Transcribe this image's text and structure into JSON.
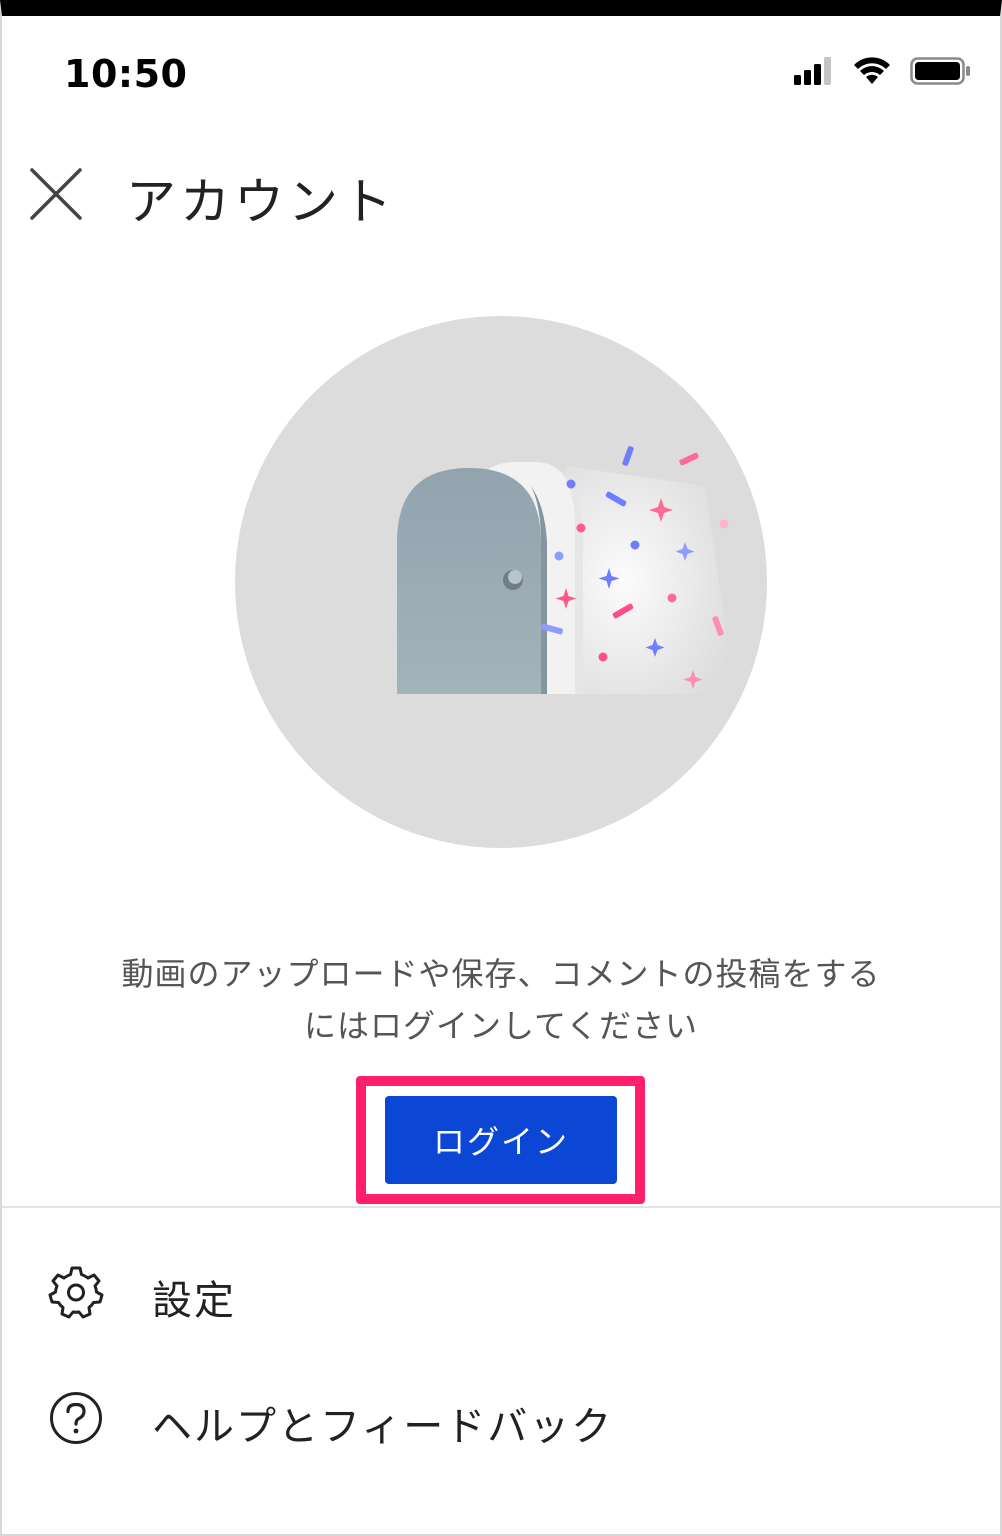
{
  "status_bar": {
    "time": "10:50"
  },
  "header": {
    "title": "アカウント",
    "close_icon": "close-icon"
  },
  "main": {
    "message_line1": "動画のアップロードや保存、コメントの投稿をする",
    "message_line2": "にはログインしてください",
    "login_label": "ログイン"
  },
  "menu": {
    "items": [
      {
        "label": "設定",
        "icon": "gear-icon"
      },
      {
        "label": "ヘルプとフィードバック",
        "icon": "help-circle-icon"
      }
    ]
  },
  "colors": {
    "accent": "#0b47d4",
    "highlight": "#ff1f6b",
    "illustration_bg": "#dcdcdc",
    "door": "#9aabb4"
  }
}
